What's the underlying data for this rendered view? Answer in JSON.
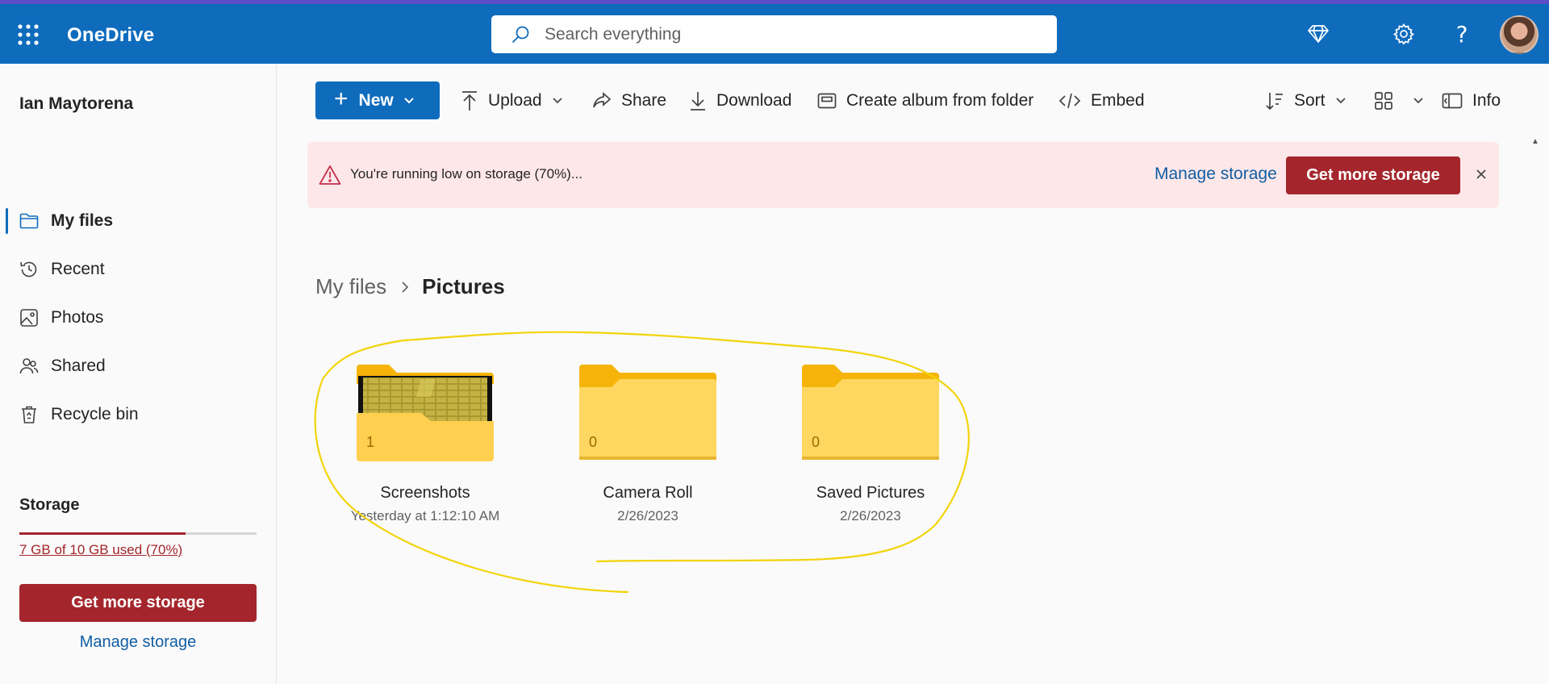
{
  "header": {
    "app_title": "OneDrive",
    "search_placeholder": "Search everything"
  },
  "sidebar": {
    "user_name": "Ian Maytorena",
    "nav": [
      {
        "label": "My files",
        "icon": "folder-icon",
        "active": true
      },
      {
        "label": "Recent",
        "icon": "history-icon",
        "active": false
      },
      {
        "label": "Photos",
        "icon": "image-icon",
        "active": false
      },
      {
        "label": "Shared",
        "icon": "people-icon",
        "active": false
      },
      {
        "label": "Recycle bin",
        "icon": "recycle-bin-icon",
        "active": false
      }
    ],
    "storage": {
      "title": "Storage",
      "used_text": "7 GB of 10 GB used (70%)",
      "used_fraction": 0.7,
      "get_more_label": "Get more storage",
      "manage_label": "Manage storage"
    }
  },
  "toolbar": {
    "new_label": "New",
    "upload_label": "Upload",
    "share_label": "Share",
    "download_label": "Download",
    "album_label": "Create album from folder",
    "embed_label": "Embed",
    "sort_label": "Sort",
    "info_label": "Info"
  },
  "banner": {
    "message": "You're running low on storage (70%)...",
    "manage_label": "Manage storage",
    "get_more_label": "Get more storage"
  },
  "breadcrumb": {
    "root": "My files",
    "current": "Pictures"
  },
  "folders": [
    {
      "name": "Screenshots",
      "date": "Yesterday at 1:12:10 AM",
      "count": "1",
      "has_thumbnail": true
    },
    {
      "name": "Camera Roll",
      "date": "2/26/2023",
      "count": "0",
      "has_thumbnail": false
    },
    {
      "name": "Saved Pictures",
      "date": "2/26/2023",
      "count": "0",
      "has_thumbnail": false
    }
  ],
  "colors": {
    "brand_blue": "#0f6cbd",
    "danger_red": "#a4262c",
    "banner_bg": "#fde7e9",
    "annotation_yellow": "#f2d40a"
  }
}
